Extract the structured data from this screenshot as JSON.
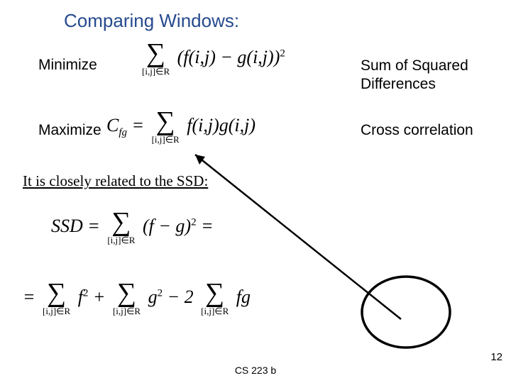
{
  "title": "Comparing Windows:",
  "labels": {
    "minimize": "Minimize",
    "maximize": "Maximize",
    "ssd_name": "Sum of Squared Differences",
    "cc_name": "Cross correlation",
    "related": "It is closely related to the SSD:"
  },
  "math": {
    "ssd": "∑_{[i,j]∈R} (f(i,j) − g(i,j))^2",
    "cc": "C_{fg} = ∑_{[i,j]∈R} f(i,j) g(i,j)",
    "expand1": "SSD = ∑_{[i,j]∈R} (f − g)^2 =",
    "expand2": "= ∑_{[i,j]∈R} f^2 + ∑_{[i,j]∈R} g^2 − 2 ∑_{[i,j]∈R} f g"
  },
  "sigma": "∑",
  "sumsub": "[i,j]∈R",
  "footer": "CS 223 b",
  "pageno": "12",
  "annotations": {
    "arrow_from_cc_to_fg_term": true,
    "circle_last_term": true
  }
}
